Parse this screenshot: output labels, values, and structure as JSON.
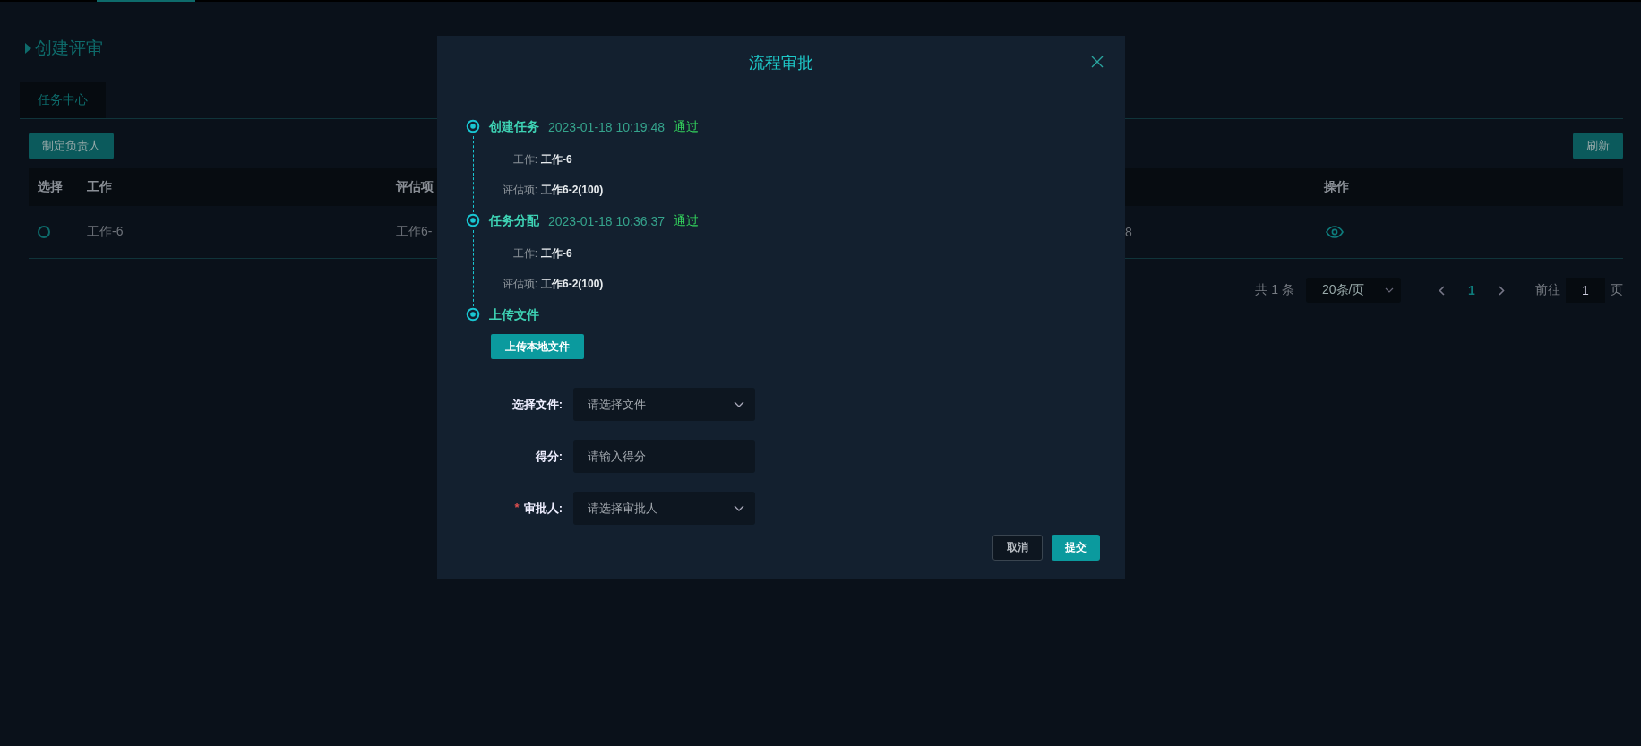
{
  "page": {
    "title": "创建评审"
  },
  "tabs": [
    {
      "label": "任务中心",
      "selected": true
    }
  ],
  "toolbar": {
    "assign_button": "制定负责人",
    "refresh_button": "刷新"
  },
  "table": {
    "columns": [
      "选择",
      "工作",
      "评估项",
      "",
      "操作"
    ],
    "rows": [
      {
        "selected": false,
        "work": "工作-6",
        "item": "工作6-",
        "column_4": "8"
      }
    ]
  },
  "pagination": {
    "total": "共 1 条",
    "page_size": "20条/页",
    "pages": [
      {
        "label": "1",
        "selected": true
      }
    ],
    "goto_label": "前往",
    "goto_value": "1",
    "goto_suffix": "页"
  },
  "dialog": {
    "title": "流程审批",
    "timeline": [
      {
        "title": "创建任务",
        "time": "2023-01-18 10:19:48",
        "status": "通过",
        "details": [
          {
            "label": "工作:",
            "value": "工作-6"
          },
          {
            "label": "评估项:",
            "value": "工作6-2(100)"
          }
        ]
      },
      {
        "title": "任务分配",
        "time": "2023-01-18 10:36:37",
        "status": "通过",
        "details": [
          {
            "label": "工作:",
            "value": "工作-6"
          },
          {
            "label": "评估项:",
            "value": "工作6-2(100)"
          }
        ]
      },
      {
        "title": "上传文件"
      }
    ],
    "upload_button": "上传本地文件",
    "fields": [
      {
        "kind": "select",
        "label": "选择文件:",
        "placeholder": "请选择文件"
      },
      {
        "kind": "input",
        "label": "得分:",
        "placeholder": "请输入得分"
      },
      {
        "kind": "select",
        "label": "审批人:",
        "placeholder": "请选择审批人",
        "required_mark": "*"
      }
    ],
    "buttons": [
      {
        "kind": "cancel",
        "label": "取消"
      },
      {
        "kind": "primary",
        "label": "提交"
      }
    ]
  }
}
